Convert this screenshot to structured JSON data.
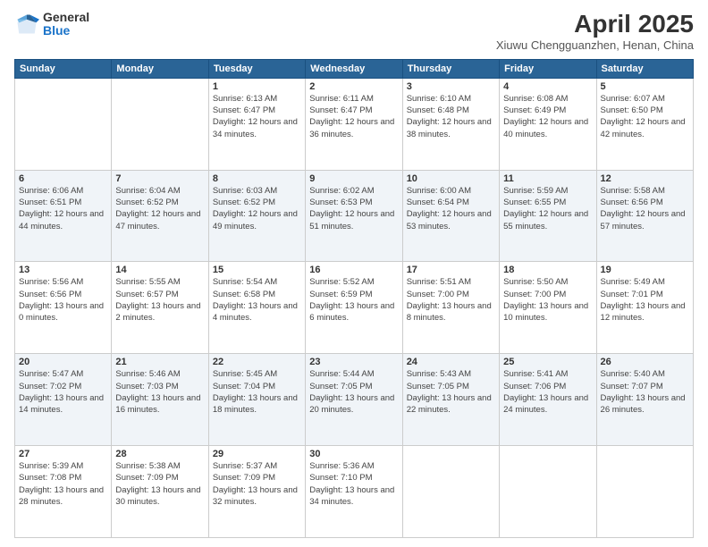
{
  "header": {
    "logo_general": "General",
    "logo_blue": "Blue",
    "title": "April 2025",
    "subtitle": "Xiuwu Chengguanzhen, Henan, China"
  },
  "weekdays": [
    "Sunday",
    "Monday",
    "Tuesday",
    "Wednesday",
    "Thursday",
    "Friday",
    "Saturday"
  ],
  "weeks": [
    [
      null,
      null,
      {
        "day": "1",
        "sunrise": "6:13 AM",
        "sunset": "6:47 PM",
        "daylight": "12 hours and 34 minutes."
      },
      {
        "day": "2",
        "sunrise": "6:11 AM",
        "sunset": "6:47 PM",
        "daylight": "12 hours and 36 minutes."
      },
      {
        "day": "3",
        "sunrise": "6:10 AM",
        "sunset": "6:48 PM",
        "daylight": "12 hours and 38 minutes."
      },
      {
        "day": "4",
        "sunrise": "6:08 AM",
        "sunset": "6:49 PM",
        "daylight": "12 hours and 40 minutes."
      },
      {
        "day": "5",
        "sunrise": "6:07 AM",
        "sunset": "6:50 PM",
        "daylight": "12 hours and 42 minutes."
      }
    ],
    [
      {
        "day": "6",
        "sunrise": "6:06 AM",
        "sunset": "6:51 PM",
        "daylight": "12 hours and 44 minutes."
      },
      {
        "day": "7",
        "sunrise": "6:04 AM",
        "sunset": "6:52 PM",
        "daylight": "12 hours and 47 minutes."
      },
      {
        "day": "8",
        "sunrise": "6:03 AM",
        "sunset": "6:52 PM",
        "daylight": "12 hours and 49 minutes."
      },
      {
        "day": "9",
        "sunrise": "6:02 AM",
        "sunset": "6:53 PM",
        "daylight": "12 hours and 51 minutes."
      },
      {
        "day": "10",
        "sunrise": "6:00 AM",
        "sunset": "6:54 PM",
        "daylight": "12 hours and 53 minutes."
      },
      {
        "day": "11",
        "sunrise": "5:59 AM",
        "sunset": "6:55 PM",
        "daylight": "12 hours and 55 minutes."
      },
      {
        "day": "12",
        "sunrise": "5:58 AM",
        "sunset": "6:56 PM",
        "daylight": "12 hours and 57 minutes."
      }
    ],
    [
      {
        "day": "13",
        "sunrise": "5:56 AM",
        "sunset": "6:56 PM",
        "daylight": "13 hours and 0 minutes."
      },
      {
        "day": "14",
        "sunrise": "5:55 AM",
        "sunset": "6:57 PM",
        "daylight": "13 hours and 2 minutes."
      },
      {
        "day": "15",
        "sunrise": "5:54 AM",
        "sunset": "6:58 PM",
        "daylight": "13 hours and 4 minutes."
      },
      {
        "day": "16",
        "sunrise": "5:52 AM",
        "sunset": "6:59 PM",
        "daylight": "13 hours and 6 minutes."
      },
      {
        "day": "17",
        "sunrise": "5:51 AM",
        "sunset": "7:00 PM",
        "daylight": "13 hours and 8 minutes."
      },
      {
        "day": "18",
        "sunrise": "5:50 AM",
        "sunset": "7:00 PM",
        "daylight": "13 hours and 10 minutes."
      },
      {
        "day": "19",
        "sunrise": "5:49 AM",
        "sunset": "7:01 PM",
        "daylight": "13 hours and 12 minutes."
      }
    ],
    [
      {
        "day": "20",
        "sunrise": "5:47 AM",
        "sunset": "7:02 PM",
        "daylight": "13 hours and 14 minutes."
      },
      {
        "day": "21",
        "sunrise": "5:46 AM",
        "sunset": "7:03 PM",
        "daylight": "13 hours and 16 minutes."
      },
      {
        "day": "22",
        "sunrise": "5:45 AM",
        "sunset": "7:04 PM",
        "daylight": "13 hours and 18 minutes."
      },
      {
        "day": "23",
        "sunrise": "5:44 AM",
        "sunset": "7:05 PM",
        "daylight": "13 hours and 20 minutes."
      },
      {
        "day": "24",
        "sunrise": "5:43 AM",
        "sunset": "7:05 PM",
        "daylight": "13 hours and 22 minutes."
      },
      {
        "day": "25",
        "sunrise": "5:41 AM",
        "sunset": "7:06 PM",
        "daylight": "13 hours and 24 minutes."
      },
      {
        "day": "26",
        "sunrise": "5:40 AM",
        "sunset": "7:07 PM",
        "daylight": "13 hours and 26 minutes."
      }
    ],
    [
      {
        "day": "27",
        "sunrise": "5:39 AM",
        "sunset": "7:08 PM",
        "daylight": "13 hours and 28 minutes."
      },
      {
        "day": "28",
        "sunrise": "5:38 AM",
        "sunset": "7:09 PM",
        "daylight": "13 hours and 30 minutes."
      },
      {
        "day": "29",
        "sunrise": "5:37 AM",
        "sunset": "7:09 PM",
        "daylight": "13 hours and 32 minutes."
      },
      {
        "day": "30",
        "sunrise": "5:36 AM",
        "sunset": "7:10 PM",
        "daylight": "13 hours and 34 minutes."
      },
      null,
      null,
      null
    ]
  ],
  "labels": {
    "sunrise": "Sunrise:",
    "sunset": "Sunset:",
    "daylight": "Daylight:"
  }
}
